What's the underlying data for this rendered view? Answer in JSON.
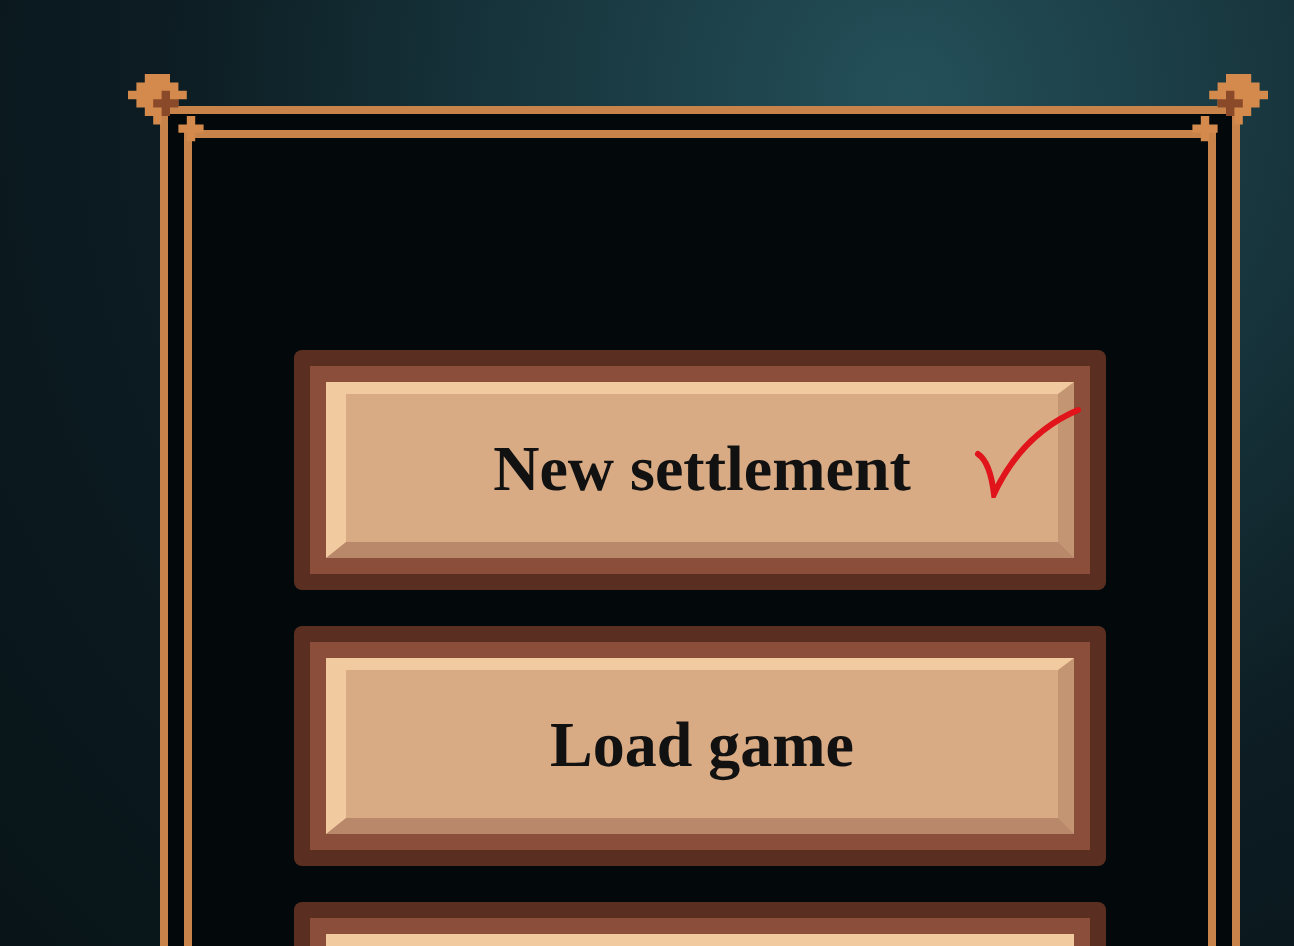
{
  "menu": {
    "buttons": [
      {
        "label": "New settlement",
        "marked": true
      },
      {
        "label": "Load game",
        "marked": false
      }
    ]
  }
}
